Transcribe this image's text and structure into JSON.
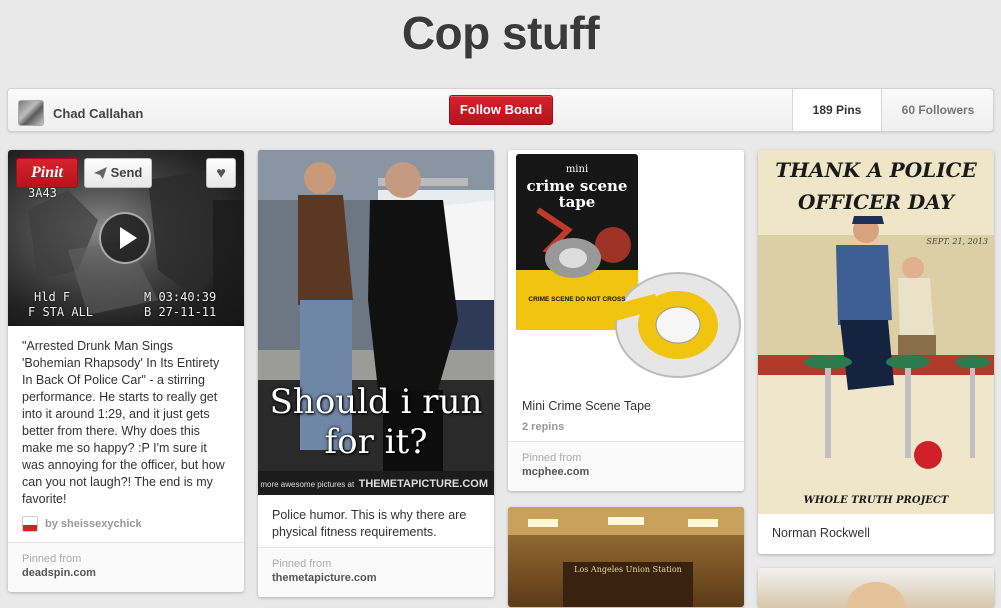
{
  "board": {
    "title": "Cop stuff",
    "owner": "Chad Callahan",
    "follow_label": "Follow Board",
    "pins_count": "189 Pins",
    "followers_count": "60 Followers"
  },
  "overlay": {
    "pinit_label": "Pinit",
    "send_label": "Send"
  },
  "pins": [
    {
      "cam_top_left": "3A43",
      "cam_bottom_left_1": "Hld F",
      "cam_bottom_left_2": "F STA  ALL",
      "cam_bottom_right_1": "M 03:40:39",
      "cam_bottom_right_2": "B 27-11-11",
      "description": "\"Arrested Drunk Man Sings 'Bohemian Rhapsody' In Its Entirety In Back Of Police Car\" - a stirring performance. He starts to really get into it around 1:29, and it just gets better from there. Why does this make me so happy? :P I'm sure it was annoying for the officer, but how can you not laugh?! The end is my favorite!",
      "via": "by sheissexychick",
      "pinned_label": "Pinned from",
      "source": "deadspin.com"
    },
    {
      "caption": "Should i run for it?",
      "watermark_small": "more awesome pictures at",
      "watermark_big": "THEMETAPICTURE.COM",
      "description": "Police humor. This is why there are physical fitness requirements.",
      "pinned_label": "Pinned from",
      "source": "themetapicture.com"
    },
    {
      "package_title_1": "mini",
      "package_title_2": "crime scene",
      "package_title_3": "tape",
      "tape_text": "CRIME SCENE DO NOT CROSS",
      "description": "Mini Crime Scene Tape",
      "repins": "2 repins",
      "pinned_label": "Pinned from",
      "source": "mcphee.com"
    },
    {
      "poster_title_1": "THANK A POLICE",
      "poster_title_2": "OFFICER DAY",
      "poster_date": "SEPT. 21, 2013",
      "poster_footer": "WHOLE TRUTH PROJECT",
      "description": "Norman Rockwell"
    },
    {
      "sign_text": "Los Angeles Union Station"
    }
  ]
}
